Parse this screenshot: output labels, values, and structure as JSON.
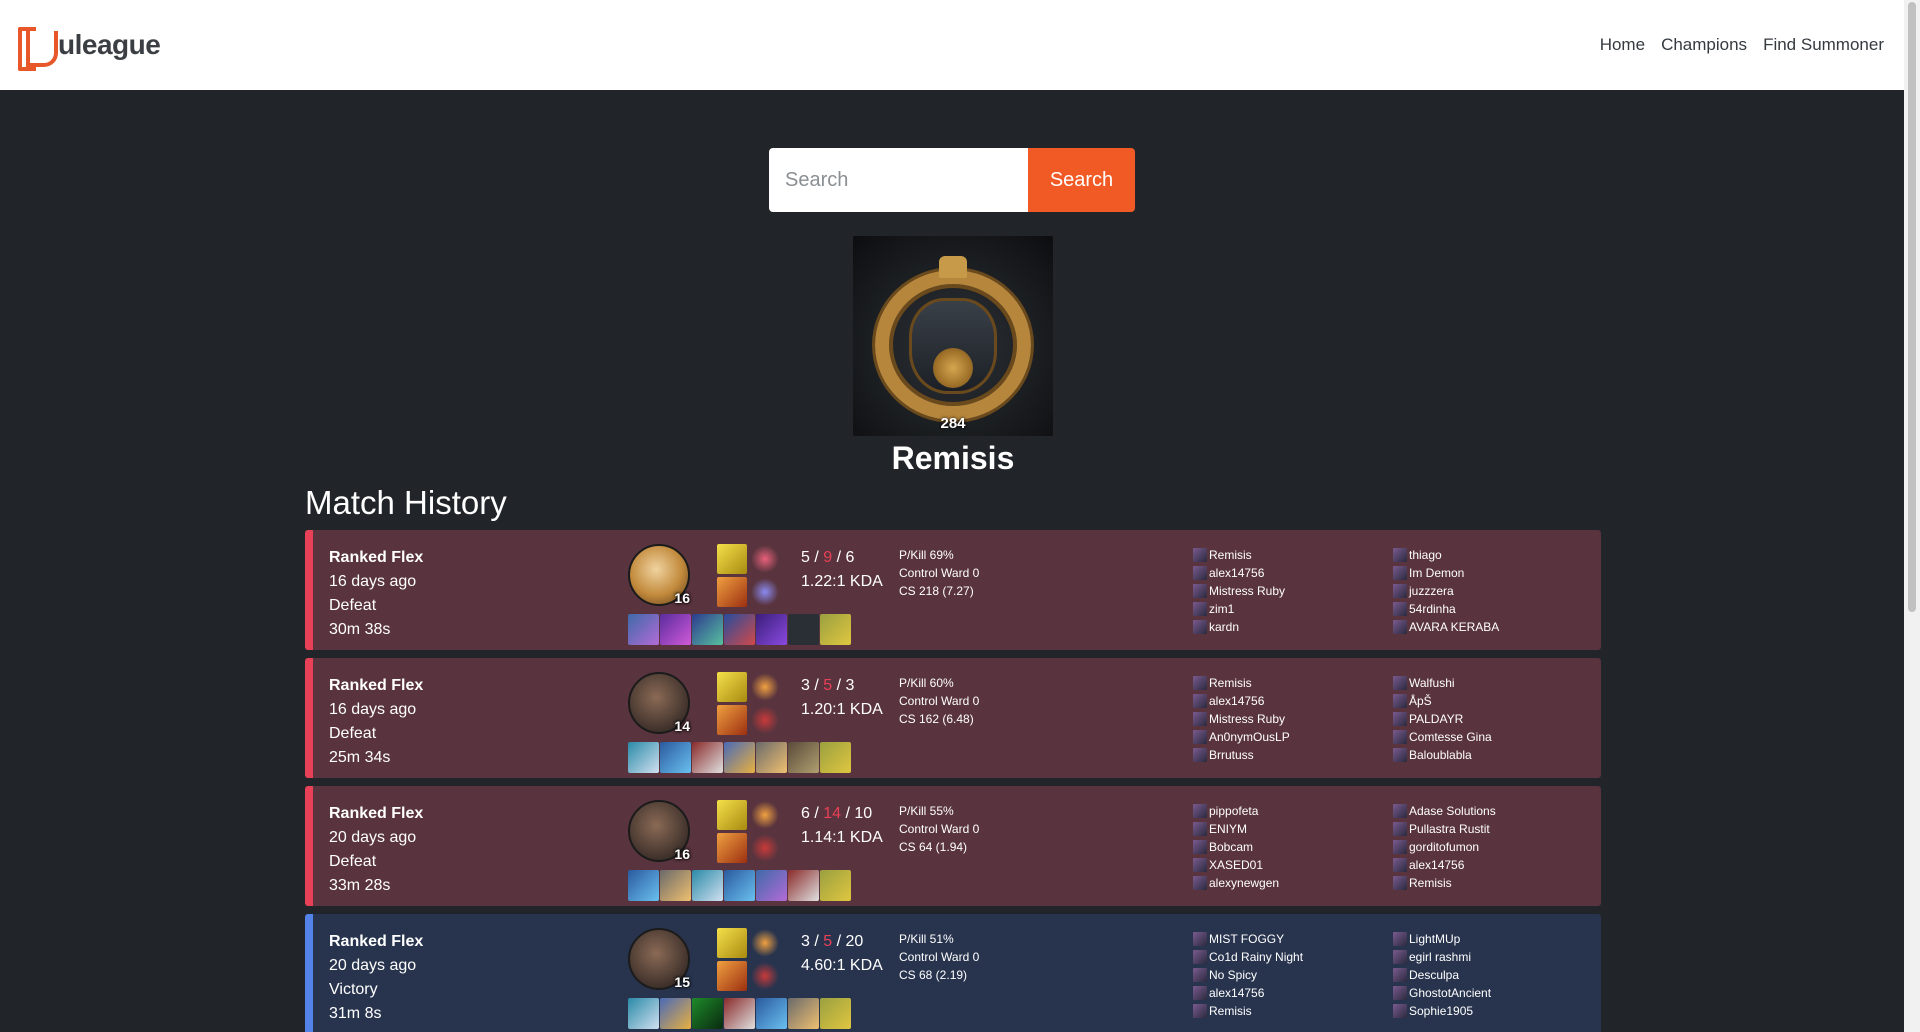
{
  "brand": {
    "name": "uleague"
  },
  "nav": {
    "home": "Home",
    "champions": "Champions",
    "find_summoner": "Find Summoner"
  },
  "search": {
    "placeholder": "Search",
    "button": "Search"
  },
  "summoner": {
    "level": "284",
    "name": "Remisis"
  },
  "section_title": "Match History",
  "colors": {
    "accent": "#f15a24",
    "defeat_bg": "#59343e",
    "defeat_bar": "#e84057",
    "victory_bg": "#28344e",
    "victory_bar": "#5383e8"
  },
  "matches": [
    {
      "queue": "Ranked Flex",
      "ago": "16 days ago",
      "result": "Defeat",
      "duration": "30m 38s",
      "champ_level": "16",
      "kills": "5",
      "deaths": "9",
      "assists": "6",
      "kda": "1.22:1 KDA",
      "pkill": "P/Kill 69%",
      "control_ward": "Control Ward 0",
      "cs": "CS 218 (7.27)",
      "team1": [
        "Remisis",
        "alex14756",
        "Mistress Ruby",
        "zim1",
        "kardn"
      ],
      "team2": [
        "thiago",
        "Im Demon",
        "juzzzera",
        "54rdinha",
        "AVARA KERABA"
      ]
    },
    {
      "queue": "Ranked Flex",
      "ago": "16 days ago",
      "result": "Defeat",
      "duration": "25m 34s",
      "champ_level": "14",
      "kills": "3",
      "deaths": "5",
      "assists": "3",
      "kda": "1.20:1 KDA",
      "pkill": "P/Kill 60%",
      "control_ward": "Control Ward 0",
      "cs": "CS 162 (6.48)",
      "team1": [
        "Remisis",
        "alex14756",
        "Mistress Ruby",
        "An0nymOusLP",
        "Brrutuss"
      ],
      "team2": [
        "Walfushi",
        "ÅpŠ",
        "PALDAYR",
        "Comtesse Gina",
        "Baloublabla"
      ]
    },
    {
      "queue": "Ranked Flex",
      "ago": "20 days ago",
      "result": "Defeat",
      "duration": "33m 28s",
      "champ_level": "16",
      "kills": "6",
      "deaths": "14",
      "assists": "10",
      "kda": "1.14:1 KDA",
      "pkill": "P/Kill 55%",
      "control_ward": "Control Ward 0",
      "cs": "CS 64 (1.94)",
      "team1": [
        "pippofeta",
        "ENIYM",
        "Bobcam",
        "XASED01",
        "alexynewgen"
      ],
      "team2": [
        "Adase Solutions",
        "Pullastra Rustit",
        "gorditofumon",
        "alex14756",
        "Remisis"
      ]
    },
    {
      "queue": "Ranked Flex",
      "ago": "20 days ago",
      "result": "Victory",
      "duration": "31m 8s",
      "champ_level": "15",
      "kills": "3",
      "deaths": "5",
      "assists": "20",
      "kda": "4.60:1 KDA",
      "pkill": "P/Kill 51%",
      "control_ward": "Control Ward 0",
      "cs": "CS 68 (2.19)",
      "team1": [
        "MIST FOGGY",
        "Co1d Rainy Night",
        "No Spicy",
        "alex14756",
        "Remisis"
      ],
      "team2": [
        "LightMUp",
        "egirl rashmi",
        "Desculpa",
        "GhostotAncient",
        "Sophie1905"
      ]
    }
  ]
}
